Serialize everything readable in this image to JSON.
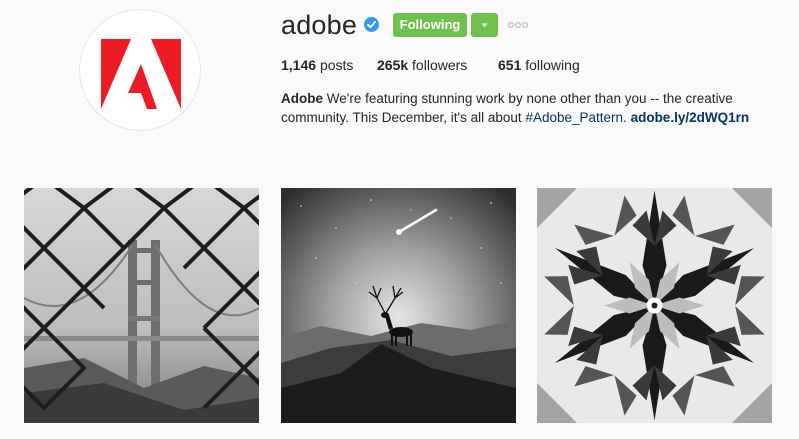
{
  "profile": {
    "username": "adobe",
    "verified_icon": "verified-badge-icon",
    "follow_label": "Following",
    "dropdown_icon": "caret-down-icon",
    "more_icon": "ellipsis-icon",
    "avatar_icon": "adobe-logo-icon"
  },
  "stats": {
    "posts_count": "1,146",
    "posts_label": "posts",
    "followers_count": "265k",
    "followers_label": "followers",
    "following_count": "651",
    "following_label": "following"
  },
  "bio": {
    "name": "Adobe",
    "text": "We're featuring stunning work by none other than you -- the creative community. This December, it's all about",
    "hashtag": "#Adobe_Pattern.",
    "link": "adobe.ly/2dWQ1rn"
  },
  "posts": [
    {
      "name": "golden-gate-bridge-through-fence-photo"
    },
    {
      "name": "deer-under-shooting-star-photo"
    },
    {
      "name": "kaleidoscope-pattern-photo"
    }
  ],
  "colors": {
    "follow_green": "#70c050",
    "verified_blue": "#3897f0",
    "adobe_red": "#ed1c24",
    "link_blue": "#003569"
  }
}
